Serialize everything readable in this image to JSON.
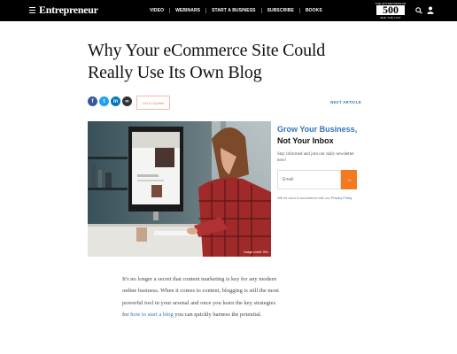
{
  "nav": {
    "logo": "Entrepreneur",
    "links": [
      "VIDEO",
      "WEBINARS",
      "START A BUSINESS",
      "SUBSCRIBE",
      "BOOKS"
    ],
    "badge_top": "THE ENTREPRENEUR",
    "badge_number": "500",
    "badge_bottom": "SEE THE LIST"
  },
  "article": {
    "title": "Why Your eCommerce Site Could Really Use Its Own Blog",
    "update_button": "Get to Update",
    "next_article": "NEXT ARTICLE",
    "image_credit": "Image credit: 99's",
    "body_before_link": "It's no longer a secret that content marketing is key for any modern online business. When it comes to content, blogging is still the most powerful tool in your arsenal and once you learn the key strategies for ",
    "body_link": "how to start a blog",
    "body_after_link": " you can quickly harness the potential."
  },
  "share": {
    "facebook": "f",
    "twitter": "t",
    "linkedin": "in",
    "link": "∞"
  },
  "newsletter": {
    "title_line1": "Grow Your Business,",
    "title_line2": "Not Your Inbox",
    "description": "Stay informed and join our daily newsletter now!",
    "email_placeholder": "Email",
    "submit_icon": "→",
    "note_prefix": "Will be used in accordance with our ",
    "privacy_link": "Privacy Policy"
  },
  "icons": {
    "menu": "hamburger-icon",
    "search": "search-icon",
    "account": "user-icon"
  },
  "colors": {
    "nav_bg": "#000000",
    "accent_blue": "#3574b8",
    "accent_orange": "#f47a20"
  }
}
